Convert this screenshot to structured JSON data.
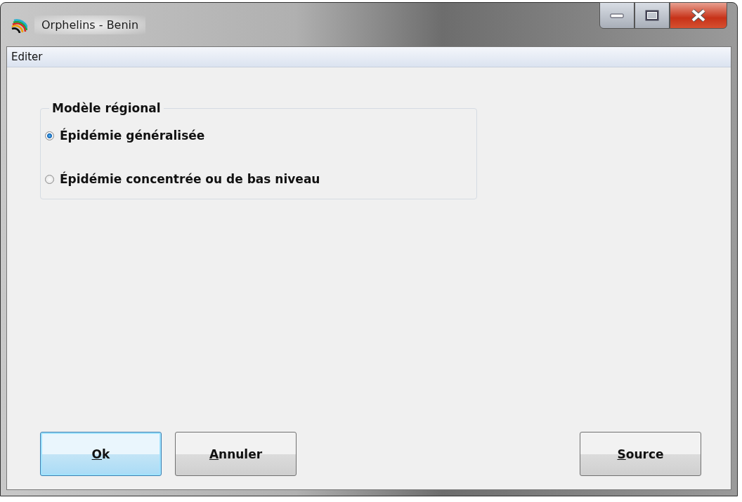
{
  "window": {
    "title": "Orphelins - Benin"
  },
  "menu": [
    {
      "label": "Editer"
    }
  ],
  "group": {
    "title": "Modèle régional",
    "options": [
      {
        "label": "Épidémie généralisée",
        "selected": true
      },
      {
        "label": "Épidémie concentrée ou de bas niveau",
        "selected": false
      }
    ]
  },
  "buttons_left": [
    {
      "label": "Ok",
      "default": true,
      "underline_first": true
    },
    {
      "label": "Annuler",
      "default": false,
      "underline_first": true
    }
  ],
  "buttons_right": [
    {
      "label": "Source",
      "default": false,
      "underline_first": true
    }
  ]
}
